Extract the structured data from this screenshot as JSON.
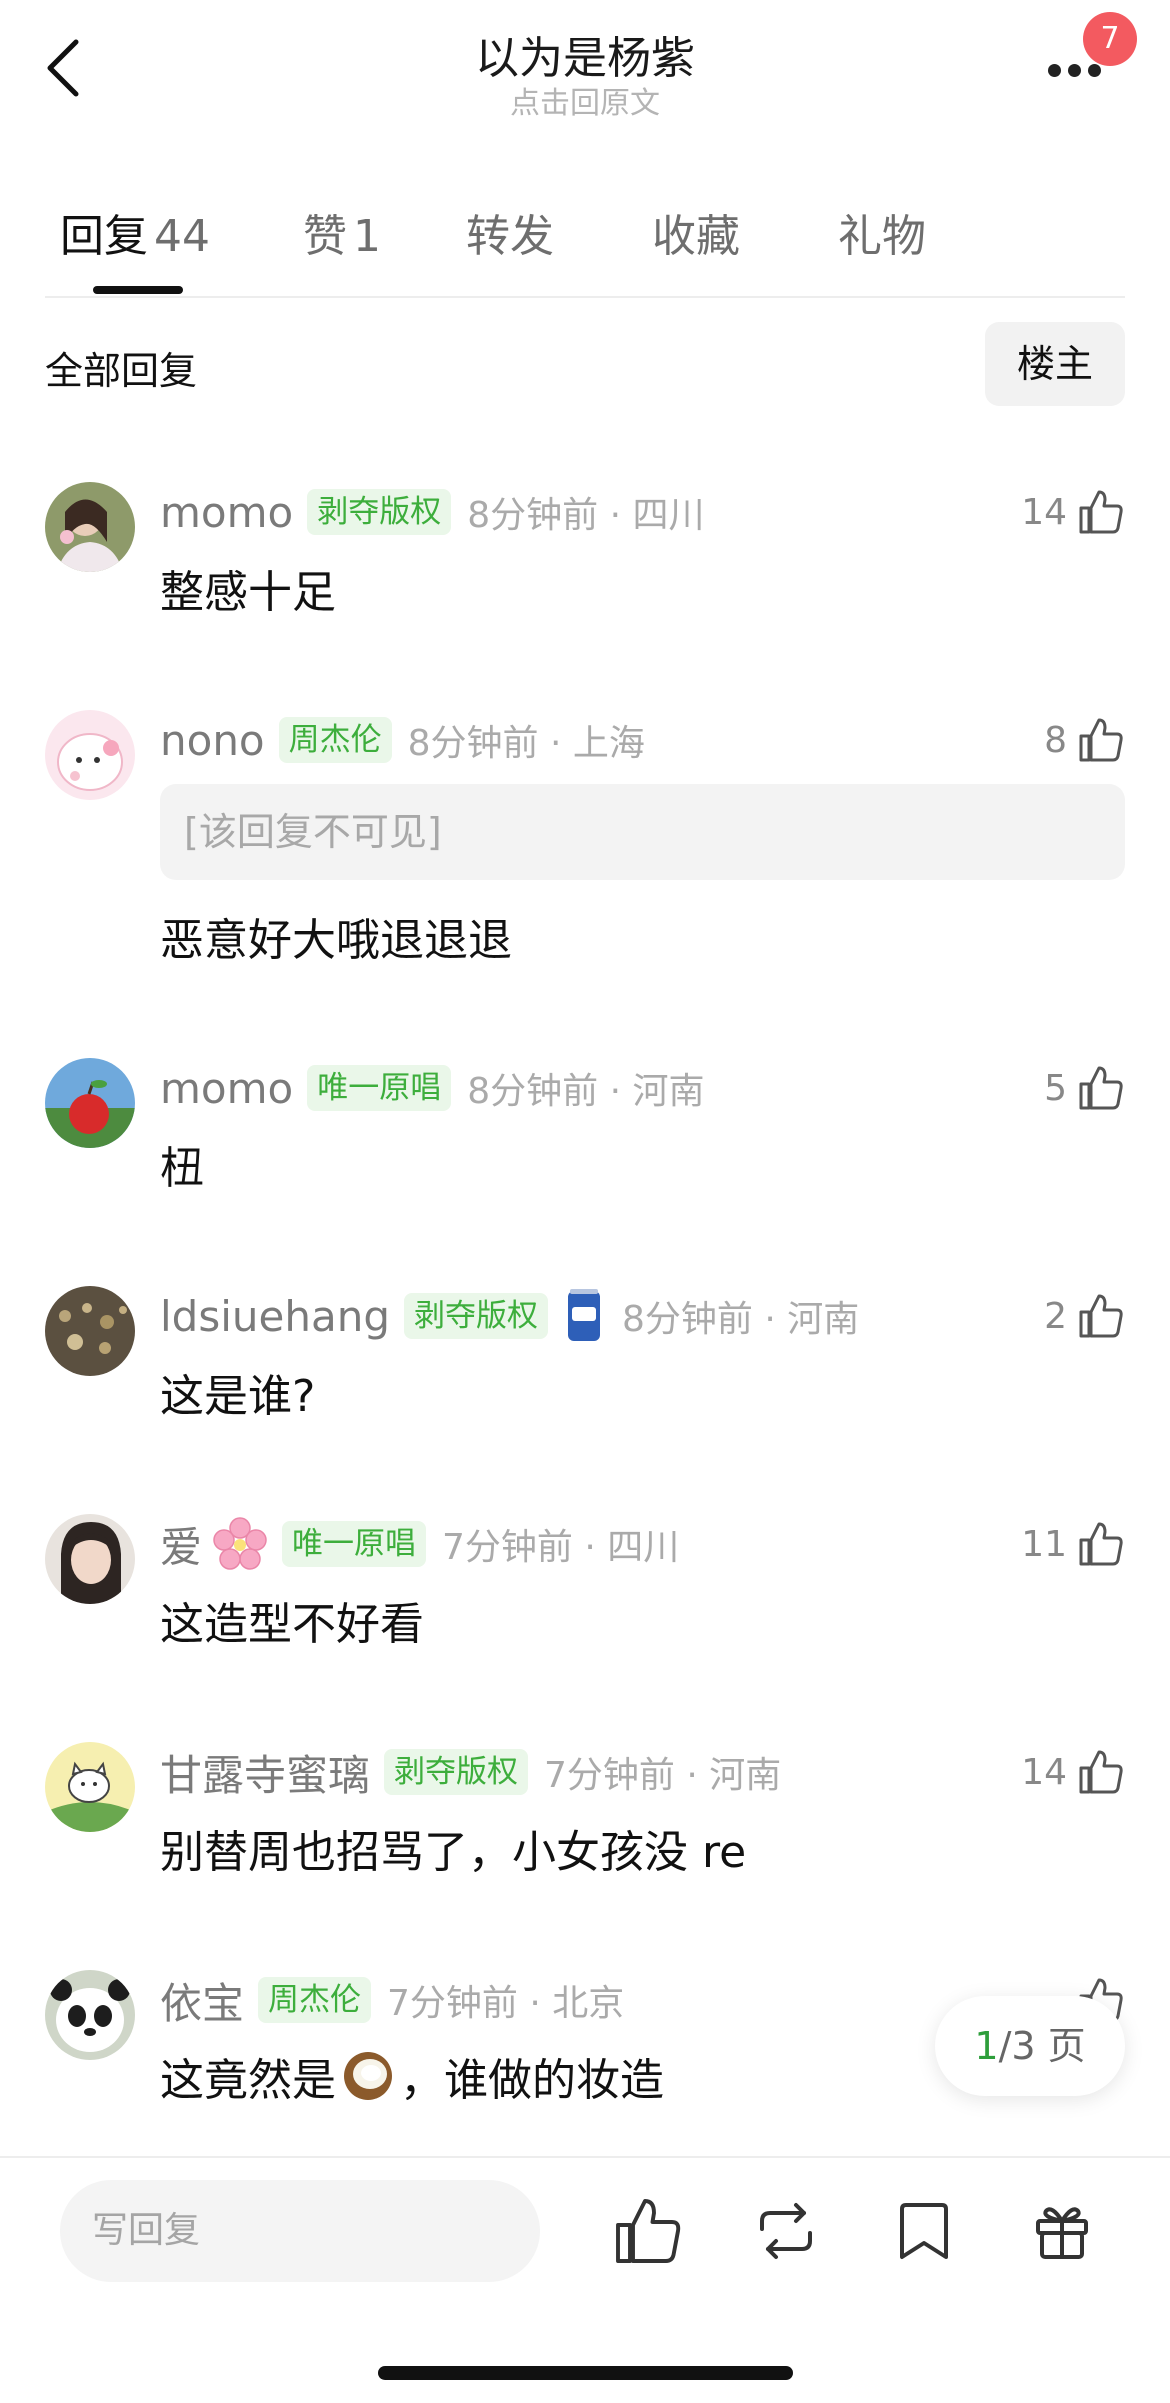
{
  "header": {
    "title": "以为是杨紫",
    "subtitle": "点击回原文",
    "notification_count": "7"
  },
  "tabs": [
    {
      "label": "回复",
      "count": "44"
    },
    {
      "label": "赞",
      "count": "1"
    },
    {
      "label": "转发",
      "count": ""
    },
    {
      "label": "收藏",
      "count": ""
    },
    {
      "label": "礼物",
      "count": ""
    }
  ],
  "filter": {
    "all_label": "全部回复",
    "owner_label": "楼主"
  },
  "comments": [
    {
      "user": "momo",
      "tag": "剥夺版权",
      "time": "8分钟前 · 四川",
      "likes": "14",
      "text": "整感十足"
    },
    {
      "user": "nono",
      "tag": "周杰伦",
      "time": "8分钟前 · 上海",
      "likes": "8",
      "quote": "[该回复不可见]",
      "text": "恶意好大哦退退退"
    },
    {
      "user": "momo",
      "tag": "唯一原唱",
      "time": "8分钟前 · 河南",
      "likes": "5",
      "text": "杻"
    },
    {
      "user": "ldsiuehang",
      "tag": "剥夺版权",
      "time": "8分钟前 · 河南",
      "likes": "2",
      "text": "这是谁?"
    },
    {
      "user": "爱",
      "tag": "唯一原唱",
      "time": "7分钟前 · 四川",
      "likes": "11",
      "text": "这造型不好看"
    },
    {
      "user": "甘露寺蜜璃",
      "tag": "剥夺版权",
      "time": "7分钟前 · 河南",
      "likes": "14",
      "text": "别替周也招骂了，小女孩没 re"
    },
    {
      "user": "依宝",
      "tag": "周杰伦",
      "time": "7分钟前 · 北京",
      "likes": "",
      "text_before": "这竟然是",
      "text_after": "，谁做的妆造"
    }
  ],
  "pager": {
    "current": "1",
    "total": "/3 页"
  },
  "bottom_bar": {
    "reply_placeholder": "写回复"
  }
}
